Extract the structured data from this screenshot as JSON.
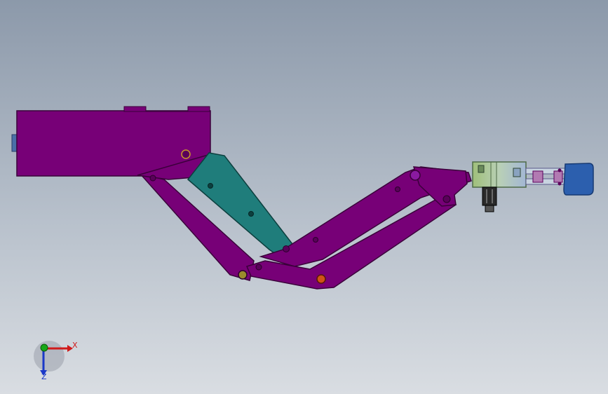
{
  "viewport": {
    "background_top": "#8c99aa",
    "background_bottom": "#d9dde2"
  },
  "model": {
    "colors": {
      "frame": "#770077",
      "frame_edge": "#3a003a",
      "link_teal": "#1f7d7b",
      "link_teal_edge": "#0c3f3e",
      "gripper_body": "#a6c39a",
      "gripper_dark": "#4e6b47",
      "tool_pad": "#2c5fae",
      "tool_pad_edge": "#173a73",
      "pin_orange": "#d05217",
      "pin_olive": "#9a8a2c"
    }
  },
  "triad": {
    "x_label": "X",
    "z_label": "Z",
    "x_color": "#d01a1a",
    "y_color": "#18a818",
    "z_color": "#1a38c8"
  }
}
